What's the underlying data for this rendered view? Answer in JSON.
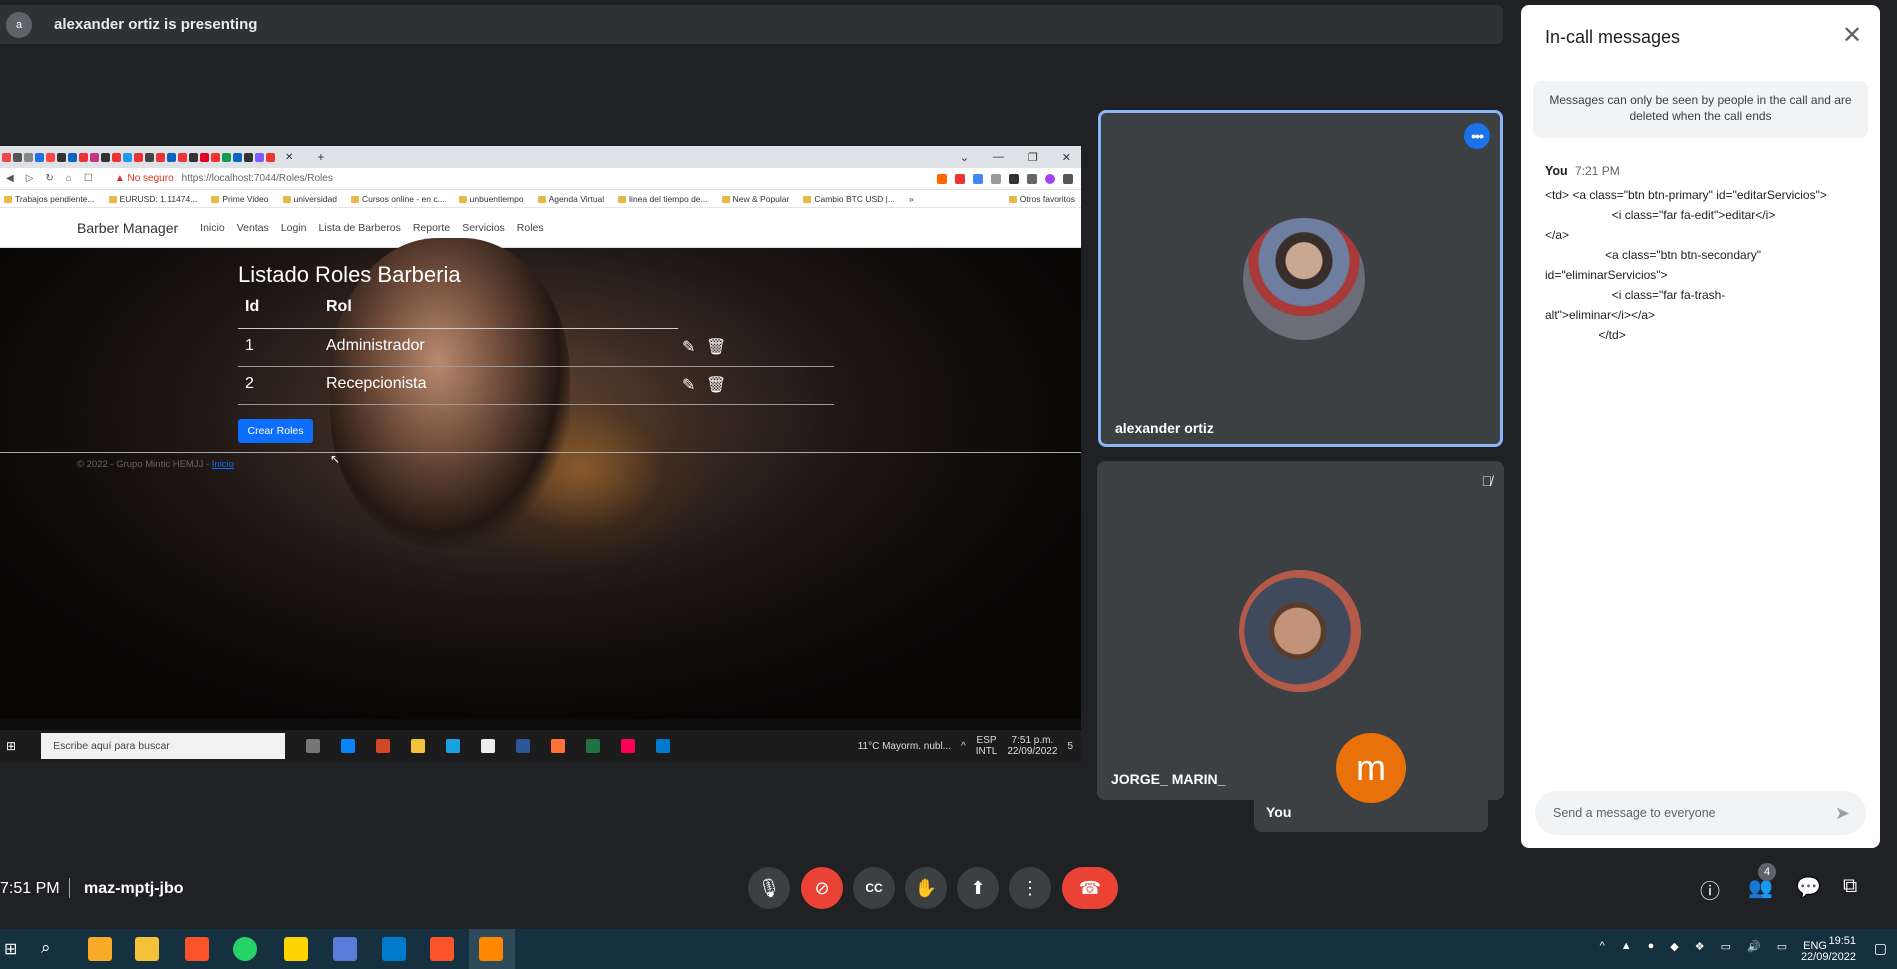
{
  "presenting": {
    "avatar_initial": "a",
    "text": "alexander ortiz is presenting"
  },
  "shared": {
    "window_controls": [
      "⌄",
      "—",
      "❐",
      "✕"
    ],
    "address": {
      "warning": "▲ No seguro",
      "url": "https://localhost:7044/Roles/Roles"
    },
    "bookmarks": [
      "Trabajos pendiente...",
      "EURUSD: 1.11474...",
      "Prime Video",
      "universidad",
      "Cursos online - en c...",
      "unbuentiempo",
      "Agenda Virtual",
      "linea del tiempo de...",
      "New & Popular",
      "Cambio BTC USD |..."
    ],
    "bookmarks_more": "»",
    "other_favorites": "Otros favoritos",
    "app": {
      "brand": "Barber Manager",
      "links": [
        "Inicio",
        "Ventas",
        "Login",
        "Lista de Barberos",
        "Reporte",
        "Servicios",
        "Roles"
      ],
      "heading": "Listado Roles Barberia",
      "columns": [
        "Id",
        "Rol"
      ],
      "rows": [
        {
          "id": "1",
          "rol": "Administrador"
        },
        {
          "id": "2",
          "rol": "Recepcionista"
        }
      ],
      "create_button": "Crear Roles",
      "footer": "© 2022 - Grupo Mintic HEMJJ -",
      "footer_link": "Inicio"
    },
    "taskbar": {
      "search": "Escribe aquí para buscar",
      "weather": "11°C  Mayorm. nubl...",
      "lang": [
        "ESP",
        "INTL"
      ],
      "time": "7:51 p.m.",
      "date": "22/09/2022",
      "notif_count": "5"
    }
  },
  "participants": [
    {
      "name": "alexander ortiz"
    },
    {
      "name": "JORGE_ MARIN_"
    }
  ],
  "self": {
    "initial": "m",
    "label": "You"
  },
  "chat": {
    "title": "In-call messages",
    "notice": "Messages can only be seen by people in the call and are deleted when the call ends",
    "sender": "You",
    "time": "7:21 PM",
    "message": "<td> <a class=\"btn btn-primary\" id=\"editarServicios\">\n                    <i class=\"far fa-edit\">editar</i>\n</a>\n                  <a class=\"btn btn-secondary\"\nid=\"eliminarServicios\">\n                    <i class=\"far fa-trash-\nalt\">eliminar</i></a>\n                </td>",
    "input_placeholder": "Send a message to everyone"
  },
  "bottom": {
    "clock": "7:51 PM",
    "meeting_code": "maz-mptj-jbo",
    "people_count": "4"
  },
  "windows": {
    "time": "19:51",
    "date": "22/09/2022",
    "lang": "ENG"
  },
  "colors": {
    "accent": "#1a73e8",
    "hangup": "#ea4335",
    "self_avatar": "#e8710a",
    "active_border": "#8ab4f8"
  }
}
